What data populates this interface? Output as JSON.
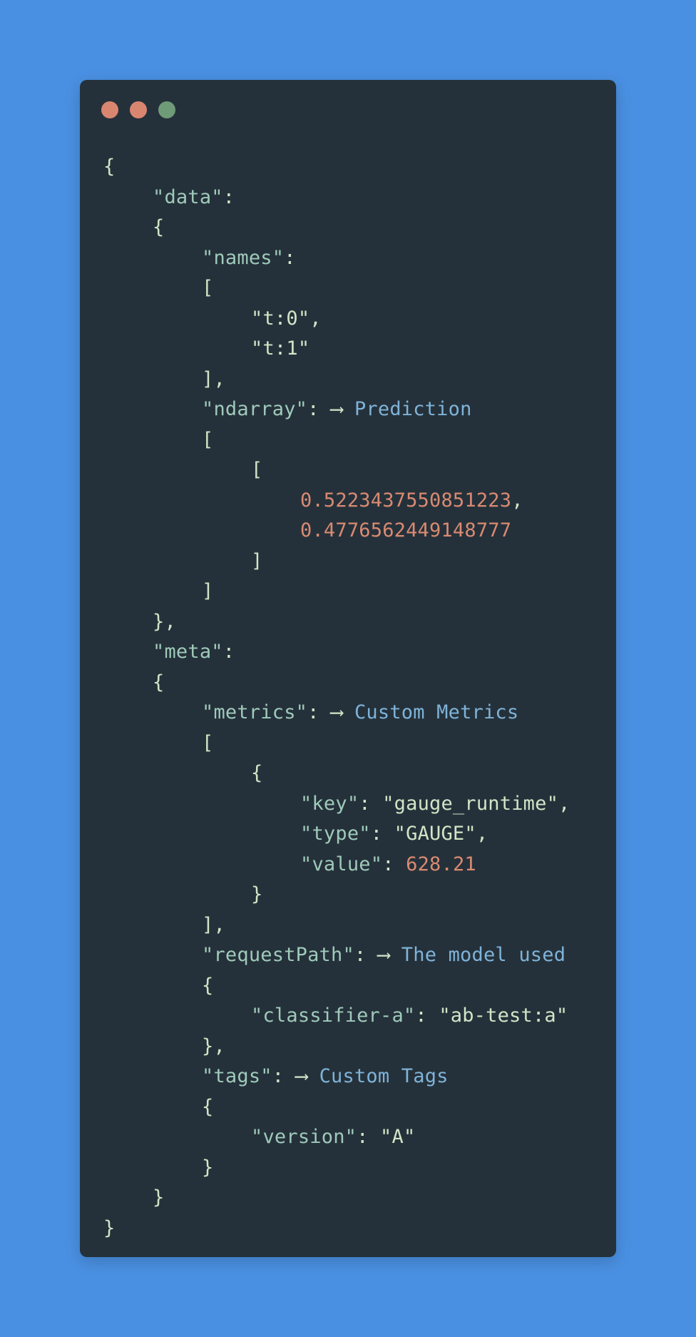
{
  "colors": {
    "background": "#4a90e2",
    "window": "#25313a",
    "dot_close": "#d98670",
    "dot_minimize": "#d98670",
    "dot_maximize": "#6f9b78",
    "punctuation": "#cfe6c7",
    "key": "#9fcaba",
    "number": "#d98a72",
    "annotation": "#7fb3d9"
  },
  "window": {
    "dots": [
      "close",
      "minimize",
      "maximize"
    ]
  },
  "code": {
    "arrow": "⟶",
    "lines": [
      {
        "indent": 0,
        "tokens": [
          {
            "t": "punct",
            "v": "{"
          }
        ]
      },
      {
        "indent": 1,
        "tokens": [
          {
            "t": "key",
            "v": "\"data\""
          },
          {
            "t": "punct",
            "v": ":"
          }
        ]
      },
      {
        "indent": 1,
        "tokens": [
          {
            "t": "punct",
            "v": "{"
          }
        ]
      },
      {
        "indent": 2,
        "tokens": [
          {
            "t": "key",
            "v": "\"names\""
          },
          {
            "t": "punct",
            "v": ":"
          }
        ]
      },
      {
        "indent": 2,
        "tokens": [
          {
            "t": "punct",
            "v": "["
          }
        ]
      },
      {
        "indent": 3,
        "tokens": [
          {
            "t": "str",
            "v": "\"t:0\""
          },
          {
            "t": "punct",
            "v": ","
          }
        ]
      },
      {
        "indent": 3,
        "tokens": [
          {
            "t": "str",
            "v": "\"t:1\""
          }
        ]
      },
      {
        "indent": 2,
        "tokens": [
          {
            "t": "punct",
            "v": "],"
          }
        ]
      },
      {
        "indent": 2,
        "tokens": [
          {
            "t": "key",
            "v": "\"ndarray\""
          },
          {
            "t": "punct",
            "v": ": "
          },
          {
            "t": "arrow",
            "v": "⟶"
          },
          {
            "t": "punct",
            "v": " "
          },
          {
            "t": "note",
            "v": "Prediction"
          }
        ]
      },
      {
        "indent": 2,
        "tokens": [
          {
            "t": "punct",
            "v": "["
          }
        ]
      },
      {
        "indent": 3,
        "tokens": [
          {
            "t": "punct",
            "v": "["
          }
        ]
      },
      {
        "indent": 4,
        "tokens": [
          {
            "t": "num",
            "v": "0.5223437550851223"
          },
          {
            "t": "punct",
            "v": ","
          }
        ]
      },
      {
        "indent": 4,
        "tokens": [
          {
            "t": "num",
            "v": "0.4776562449148777"
          }
        ]
      },
      {
        "indent": 3,
        "tokens": [
          {
            "t": "punct",
            "v": "]"
          }
        ]
      },
      {
        "indent": 2,
        "tokens": [
          {
            "t": "punct",
            "v": "]"
          }
        ]
      },
      {
        "indent": 1,
        "tokens": [
          {
            "t": "punct",
            "v": "},"
          }
        ]
      },
      {
        "indent": 1,
        "tokens": [
          {
            "t": "key",
            "v": "\"meta\""
          },
          {
            "t": "punct",
            "v": ":"
          }
        ]
      },
      {
        "indent": 1,
        "tokens": [
          {
            "t": "punct",
            "v": "{"
          }
        ]
      },
      {
        "indent": 2,
        "tokens": [
          {
            "t": "key",
            "v": "\"metrics\""
          },
          {
            "t": "punct",
            "v": ": "
          },
          {
            "t": "arrow",
            "v": "⟶"
          },
          {
            "t": "punct",
            "v": " "
          },
          {
            "t": "note",
            "v": "Custom Metrics"
          }
        ]
      },
      {
        "indent": 2,
        "tokens": [
          {
            "t": "punct",
            "v": "["
          }
        ]
      },
      {
        "indent": 3,
        "tokens": [
          {
            "t": "punct",
            "v": "{"
          }
        ]
      },
      {
        "indent": 4,
        "tokens": [
          {
            "t": "key",
            "v": "\"key\""
          },
          {
            "t": "punct",
            "v": ": "
          },
          {
            "t": "str",
            "v": "\"gauge_runtime\""
          },
          {
            "t": "punct",
            "v": ","
          }
        ]
      },
      {
        "indent": 4,
        "tokens": [
          {
            "t": "key",
            "v": "\"type\""
          },
          {
            "t": "punct",
            "v": ": "
          },
          {
            "t": "str",
            "v": "\"GAUGE\""
          },
          {
            "t": "punct",
            "v": ","
          }
        ]
      },
      {
        "indent": 4,
        "tokens": [
          {
            "t": "key",
            "v": "\"value\""
          },
          {
            "t": "punct",
            "v": ": "
          },
          {
            "t": "num",
            "v": "628.21"
          }
        ]
      },
      {
        "indent": 3,
        "tokens": [
          {
            "t": "punct",
            "v": "}"
          }
        ]
      },
      {
        "indent": 2,
        "tokens": [
          {
            "t": "punct",
            "v": "],"
          }
        ]
      },
      {
        "indent": 2,
        "tokens": [
          {
            "t": "key",
            "v": "\"requestPath\""
          },
          {
            "t": "punct",
            "v": ": "
          },
          {
            "t": "arrow",
            "v": "⟶"
          },
          {
            "t": "punct",
            "v": " "
          },
          {
            "t": "note",
            "v": "The model used"
          }
        ]
      },
      {
        "indent": 2,
        "tokens": [
          {
            "t": "punct",
            "v": "{"
          }
        ]
      },
      {
        "indent": 3,
        "tokens": [
          {
            "t": "key",
            "v": "\"classifier-a\""
          },
          {
            "t": "punct",
            "v": ": "
          },
          {
            "t": "str",
            "v": "\"ab-test:a\""
          }
        ]
      },
      {
        "indent": 2,
        "tokens": [
          {
            "t": "punct",
            "v": "},"
          }
        ]
      },
      {
        "indent": 2,
        "tokens": [
          {
            "t": "key",
            "v": "\"tags\""
          },
          {
            "t": "punct",
            "v": ": "
          },
          {
            "t": "arrow",
            "v": "⟶"
          },
          {
            "t": "punct",
            "v": " "
          },
          {
            "t": "note",
            "v": "Custom Tags"
          }
        ]
      },
      {
        "indent": 2,
        "tokens": [
          {
            "t": "punct",
            "v": "{"
          }
        ]
      },
      {
        "indent": 3,
        "tokens": [
          {
            "t": "key",
            "v": "\"version\""
          },
          {
            "t": "punct",
            "v": ": "
          },
          {
            "t": "str",
            "v": "\"A\""
          }
        ]
      },
      {
        "indent": 2,
        "tokens": [
          {
            "t": "punct",
            "v": "}"
          }
        ]
      },
      {
        "indent": 1,
        "tokens": [
          {
            "t": "punct",
            "v": "}"
          }
        ]
      },
      {
        "indent": 0,
        "tokens": [
          {
            "t": "punct",
            "v": "}"
          }
        ]
      }
    ]
  }
}
